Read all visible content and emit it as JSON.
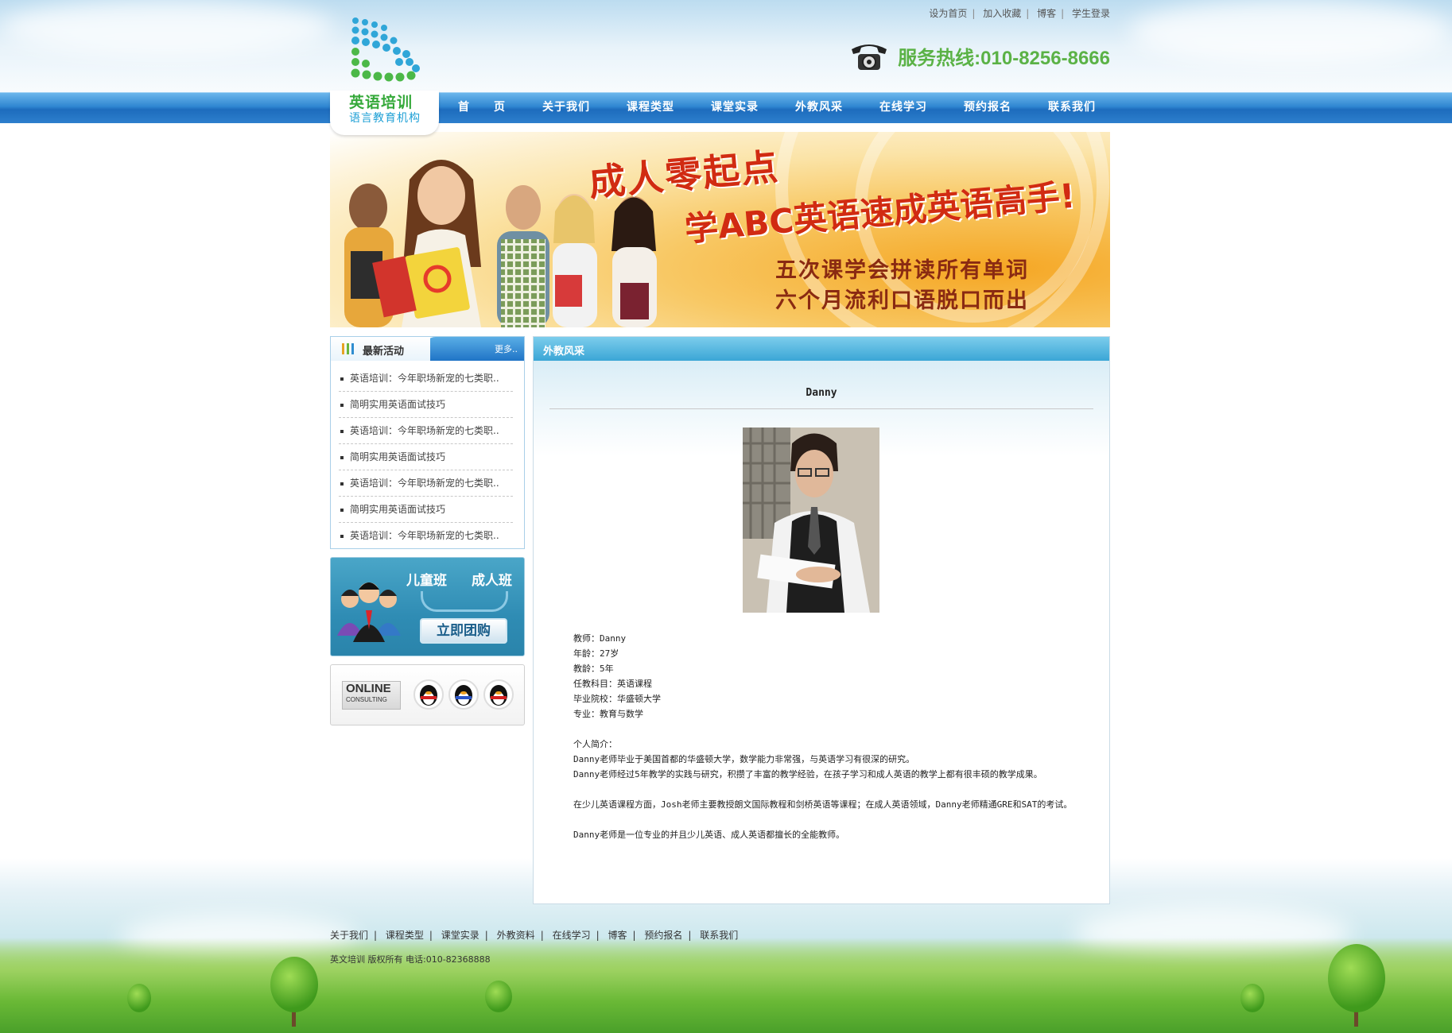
{
  "top_links": [
    "设为首页",
    "加入收藏",
    "博客",
    "学生登录"
  ],
  "hotline": "服务热线:010-8256-8666",
  "logo": {
    "title": "英语培训",
    "subtitle": "语言教育机构"
  },
  "nav": [
    "首　　页",
    "关于我们",
    "课程类型",
    "课堂实录",
    "外教风采",
    "在线学习",
    "预约报名",
    "联系我们"
  ],
  "banner": {
    "headline1": "成人零起点",
    "headline2": "学ABC英语速成英语高手!",
    "line1": "五次课学会拼读所有单词",
    "line2": "六个月流利口语脱口而出"
  },
  "news": {
    "title": "最新活动",
    "more": "更多..",
    "items": [
      "英语培训：今年职场新宠的七类职..",
      "简明实用英语面试技巧",
      "英语培训：今年职场新宠的七类职..",
      "简明实用英语面试技巧",
      "英语培训：今年职场新宠的七类职..",
      "简明实用英语面试技巧",
      "英语培训：今年职场新宠的七类职.."
    ]
  },
  "class_promo": {
    "kids": "儿童班",
    "adult": "成人班",
    "button": "立即团购"
  },
  "online": {
    "line1": "ONLINE",
    "line2": "CONSULTING"
  },
  "section": {
    "title": "外教风采",
    "teacher_name": "Danny",
    "details": [
      "教师：Danny",
      "年龄：27岁",
      "教龄：5年",
      "任教科目：英语课程",
      "毕业院校：华盛顿大学",
      "专业：教育与数学"
    ],
    "intro_label": "个人简介：",
    "intro": [
      "Danny老师毕业于美国首都的华盛顿大学，数学能力非常强，与英语学习有很深的研究。",
      "Danny老师经过5年教学的实践与研究，积攒了丰富的教学经验，在孩子学习和成人英语的教学上都有很丰硕的教学成果。"
    ],
    "para2": "在少儿英语课程方面，Josh老师主要教授朗文国际教程和剑桥英语等课程；在成人英语领域，Danny老师精通GRE和SAT的考试。",
    "para3": "Danny老师是一位专业的并且少儿英语、成人英语都擅长的全能教师。"
  },
  "footer": {
    "links": [
      "关于我们",
      "课程类型",
      "课堂实录",
      "外教资料",
      "在线学习",
      "博客",
      "预约报名",
      "联系我们"
    ],
    "copyright": "英文培训 版权所有 电话:010-82368888"
  },
  "colors": {
    "nav_blue": "#2f86d1",
    "hotline_green": "#5bb246",
    "logo_green": "#35a93a",
    "banner_red": "#d12b12"
  }
}
